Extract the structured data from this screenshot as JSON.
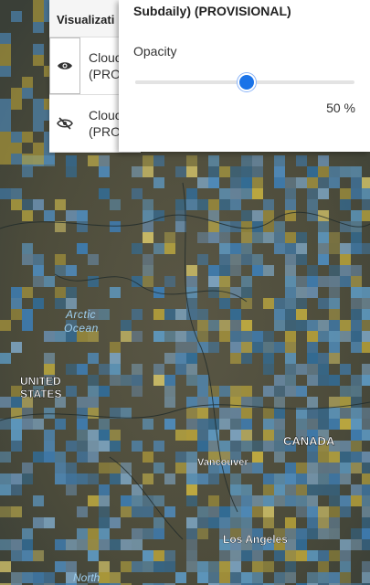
{
  "map": {
    "labels": {
      "arctic_ocean_1": "Arctic",
      "arctic_ocean_2": "Ocean",
      "united_states_1": "UNITED",
      "united_states_2": "STATES",
      "canada": "CANADA",
      "vancouver": "Vancouver",
      "los_angeles": "Los Angeles",
      "north": "North"
    }
  },
  "layers_panel": {
    "header": "Visualizati",
    "items": [
      {
        "name_line1": "Clouc",
        "name_line2": "(PROV",
        "visible": true,
        "icon": "eye-icon"
      },
      {
        "name_line1": "Clouc",
        "name_line2": "(PROVISIONAL)",
        "visible": false,
        "icon": "eye-slash-icon"
      }
    ]
  },
  "opacity_popover": {
    "title": "Subdaily) (PROVISIONAL)",
    "label": "Opacity",
    "value": 50,
    "value_text": "50 %"
  },
  "colors": {
    "accent": "#1a73e8",
    "cloud_blue": "#3d7fb8",
    "cloud_yellow": "#c9b340"
  }
}
